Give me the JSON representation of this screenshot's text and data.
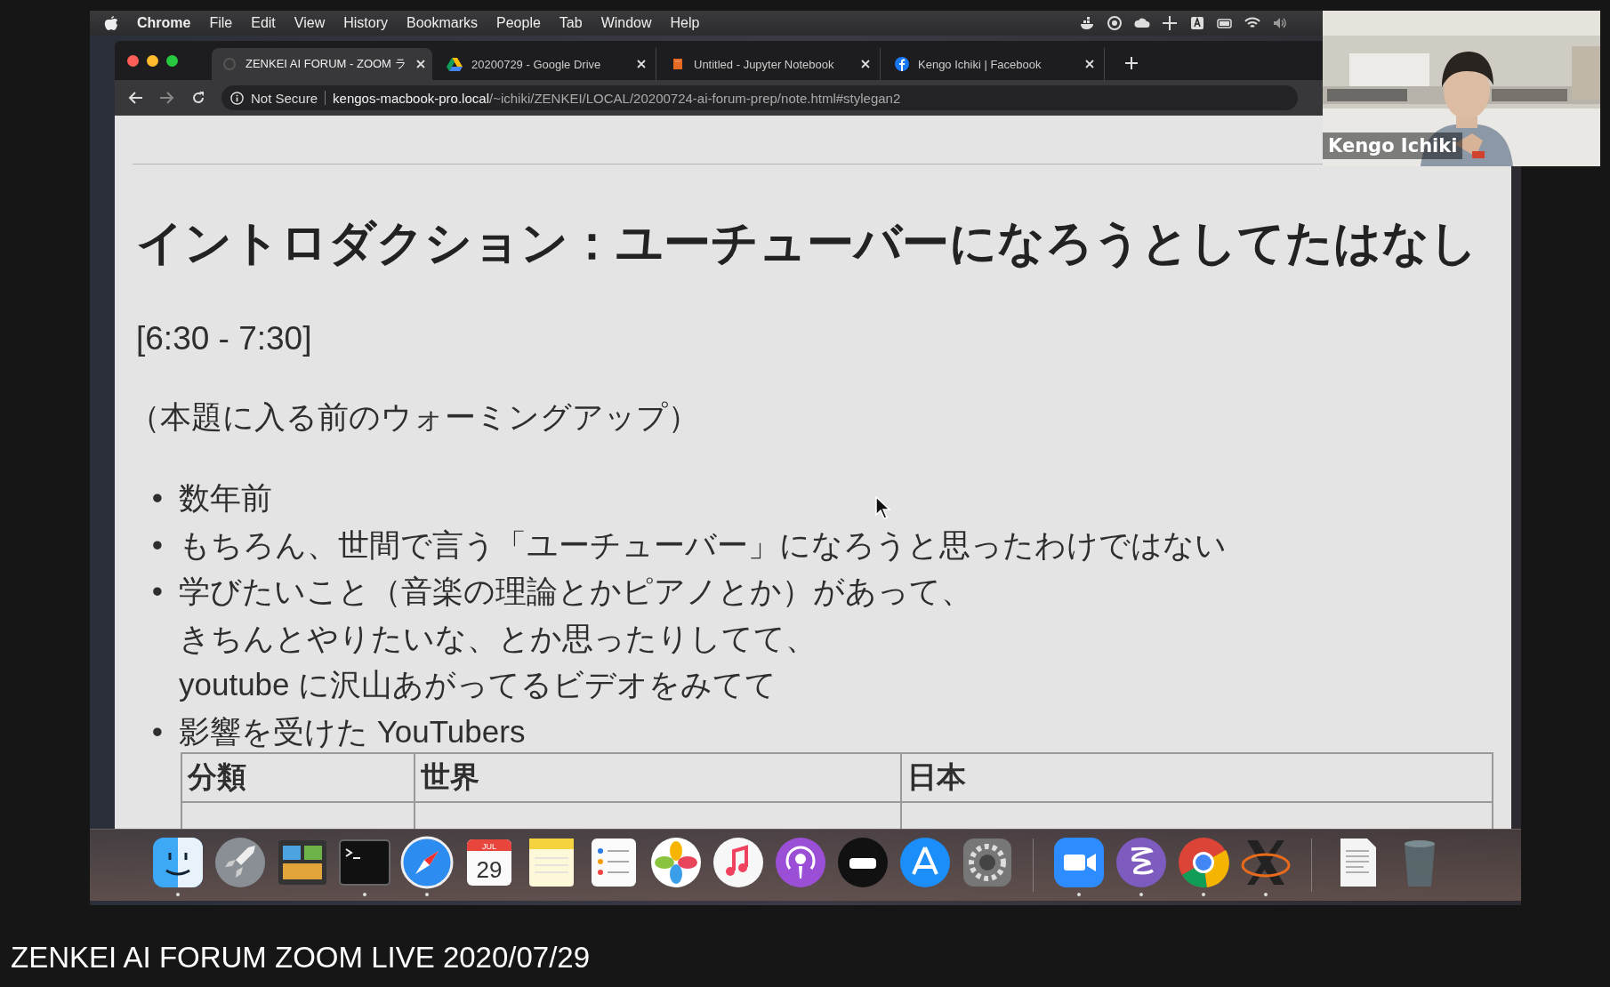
{
  "menu_bar": {
    "app": "Chrome",
    "items": [
      "File",
      "Edit",
      "View",
      "History",
      "Bookmarks",
      "People",
      "Tab",
      "Window",
      "Help"
    ]
  },
  "browser": {
    "tabs": [
      {
        "kind": "loading",
        "title": "ZENKEI AI FORUM - ZOOM ラ",
        "selected": true
      },
      {
        "kind": "drive",
        "title": "20200729 - Google Drive",
        "selected": false
      },
      {
        "kind": "notebook",
        "title": "Untitled - Jupyter Notebook",
        "selected": false
      },
      {
        "kind": "facebook",
        "title": "Kengo Ichiki | Facebook",
        "selected": false
      }
    ],
    "address": {
      "security": "Not Secure",
      "host": "kengos-macbook-pro.local",
      "path": "/~ichiki/ZENKEI/LOCAL/20200724-ai-forum-prep/note.html#stylegan2"
    }
  },
  "page": {
    "heading": "イントロダクション：ユーチューバーになろうとしてたはなし",
    "time": "[6:30 - 7:30]",
    "note": "（本題に入る前のウォーミングアップ）",
    "bullets": [
      {
        "marker": "•",
        "lines": [
          "数年前"
        ]
      },
      {
        "marker": "•",
        "lines": [
          "もちろん、世間で言う「ユーチューバー」になろうと思ったわけではない"
        ]
      },
      {
        "marker": "•",
        "lines": [
          "学びたいこと（音楽の理論とかピアノとか）があって、",
          "きちんとやりたいな、とか思ったりしてて、",
          "youtube に沢山あがってるビデオをみてて"
        ]
      },
      {
        "marker": "•",
        "lines": [
          "影響を受けた YouTubers"
        ]
      }
    ],
    "table": {
      "columns": [
        "分類",
        "世界",
        "日本"
      ]
    }
  },
  "dock": {
    "apps": [
      {
        "kind": "finder",
        "running": true
      },
      {
        "kind": "launchpad",
        "running": false
      },
      {
        "kind": "mission",
        "running": false
      },
      {
        "kind": "terminal",
        "running": true
      },
      {
        "kind": "safari",
        "running": true
      },
      {
        "kind": "calendar",
        "running": false,
        "month": "JUL",
        "day": "29"
      },
      {
        "kind": "notes",
        "running": false
      },
      {
        "kind": "reminders",
        "running": false
      },
      {
        "kind": "photos",
        "running": false
      },
      {
        "kind": "music",
        "running": false
      },
      {
        "kind": "podcasts",
        "running": false
      },
      {
        "kind": "tv",
        "running": false
      },
      {
        "kind": "appstore",
        "running": false
      },
      {
        "kind": "prefs",
        "running": false,
        "separator_after": true
      },
      {
        "kind": "zoom",
        "running": true
      },
      {
        "kind": "emacs",
        "running": true
      },
      {
        "kind": "chrome",
        "running": true
      },
      {
        "kind": "x11",
        "running": true,
        "separator_after": true
      },
      {
        "kind": "document",
        "running": false
      },
      {
        "kind": "trash",
        "running": false
      }
    ]
  },
  "video": {
    "kind": "picture",
    "name": "Kengo Ichiki"
  },
  "caption": "ZENKEI AI FORUM ZOOM LIVE 2020/07/29"
}
